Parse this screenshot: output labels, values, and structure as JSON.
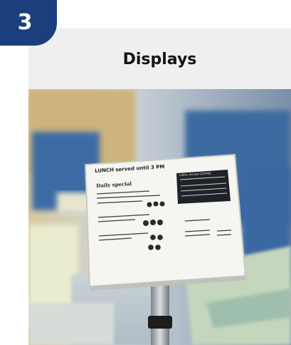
{
  "step_badge": {
    "number": "3",
    "color": "#1b3f7d"
  },
  "header": {
    "title": "Displays"
  },
  "photo": {
    "subject": "menu display sign on stand",
    "sign": {
      "heading": "LUNCH served until 3 PM",
      "subheading": "Daily special",
      "panel_title": "Coffee, tea and COFFEE"
    }
  }
}
